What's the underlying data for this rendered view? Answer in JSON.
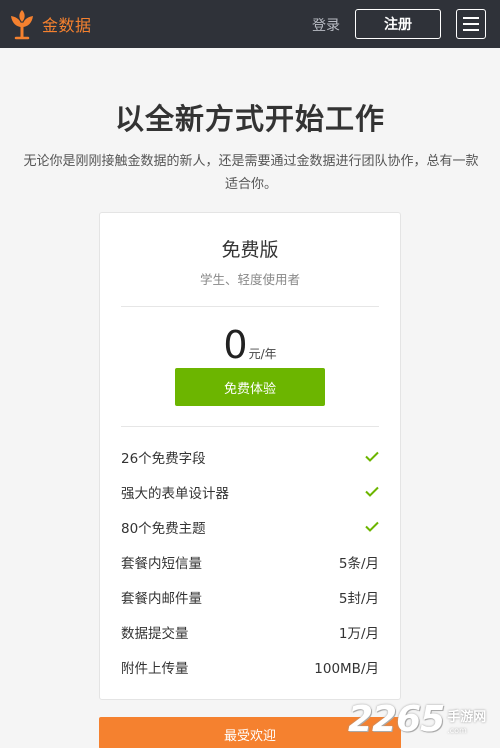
{
  "header": {
    "brand_name": "金数据",
    "login_label": "登录",
    "register_label": "注册",
    "brand_color": "#f5812f",
    "background_color": "#2f3239"
  },
  "hero": {
    "title": "以全新方式开始工作",
    "subtitle": "无论你是刚刚接触金数据的新人，还是需要通过金数据进行团队协作，总有一款适合你。"
  },
  "plan": {
    "name": "免费版",
    "description": "学生、轻度使用者",
    "price": "0",
    "price_unit": "元/年",
    "cta_label": "免费体验",
    "cta_color": "#6cb500",
    "features": [
      {
        "label": "26个免费字段",
        "value": null,
        "icon": "check-icon"
      },
      {
        "label": "强大的表单设计器",
        "value": null,
        "icon": "check-icon"
      },
      {
        "label": "80个免费主题",
        "value": null,
        "icon": "check-icon"
      },
      {
        "label": "套餐内短信量",
        "value": "5条/月"
      },
      {
        "label": "套餐内邮件量",
        "value": "5封/月"
      },
      {
        "label": "数据提交量",
        "value": "1万/月"
      },
      {
        "label": "附件上传量",
        "value": "100MB/月"
      }
    ]
  },
  "popular_banner": {
    "label": "最受欢迎",
    "color": "#f5812f"
  },
  "watermark": {
    "number": "2265",
    "chinese": "手游网",
    "latin": ".com"
  }
}
